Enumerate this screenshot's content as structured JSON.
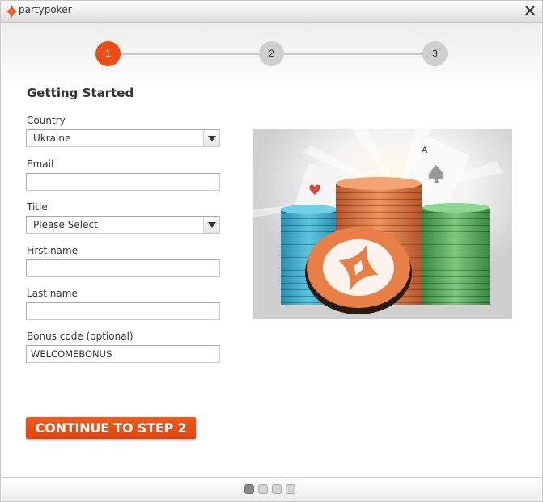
{
  "window": {
    "app_title": "partypoker",
    "close_icon": "close-icon",
    "logo_icon": "partypoker-diamond-logo-icon"
  },
  "stepper": {
    "steps": [
      {
        "label": "1",
        "state": "active"
      },
      {
        "label": "2",
        "state": "inactive"
      },
      {
        "label": "3",
        "state": "inactive"
      }
    ]
  },
  "form": {
    "heading": "Getting Started",
    "country": {
      "label": "Country",
      "value": "Ukraine"
    },
    "email": {
      "label": "Email",
      "value": ""
    },
    "title": {
      "label": "Title",
      "value": "Please Select"
    },
    "first_name": {
      "label": "First name",
      "value": ""
    },
    "last_name": {
      "label": "Last name",
      "value": ""
    },
    "bonus_code": {
      "label": "Bonus code (optional)",
      "value": "WELCOMEBONUS"
    },
    "continue_label": "CONTINUE TO STEP 2"
  },
  "promo_image": {
    "description": "Stacks of blue, orange and green poker chips with playing cards (ace of spades, hearts) and a partypoker diamond chip in front"
  },
  "pagination": {
    "total": 4,
    "active_index": 0
  },
  "colors": {
    "accent": "#e94e14",
    "step_inactive": "#cfcfcf",
    "chip_blue": "#3aa9c9",
    "chip_orange": "#e0733c",
    "chip_green": "#4fa35a"
  }
}
